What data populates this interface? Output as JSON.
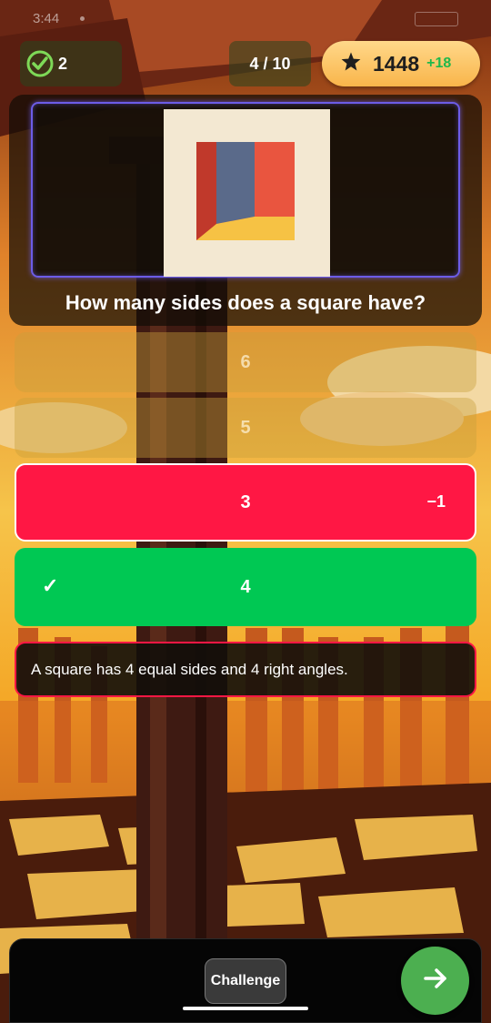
{
  "status_bar": {
    "time": "3:44"
  },
  "hud": {
    "correct_count": "2",
    "progress": "4 / 10",
    "points_total": "1448",
    "points_delta": "+18"
  },
  "question": {
    "text": "How many sides does a square have?"
  },
  "answers": [
    {
      "label": "6",
      "state": "dimmed"
    },
    {
      "label": "5",
      "state": "dimmed"
    },
    {
      "label": "3",
      "state": "wrong",
      "penalty": "−1"
    },
    {
      "label": "4",
      "state": "correct",
      "mark": "✓"
    }
  ],
  "explanation": "A square has 4 equal sides and 4 right angles.",
  "bottom_bar": {
    "challenge_label": "Challenge"
  },
  "icons": {
    "score": "check-circle-icon",
    "points": "star-icon",
    "next": "arrow-right-icon"
  },
  "colors": {
    "wrong": "#ff1744",
    "correct": "#00c853",
    "frame": "#6c5ce7",
    "next": "#4caf50",
    "delta": "#1fb84b"
  }
}
